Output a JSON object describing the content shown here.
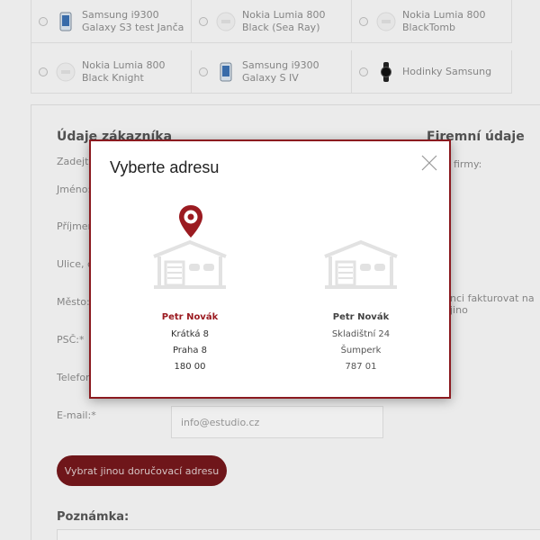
{
  "products": [
    {
      "name": "Samsung i9300 Galaxy S3 test Janča",
      "icon": "phone-icon"
    },
    {
      "name": "Nokia Lumia 800 Black (Sea Ray)",
      "icon": "phone-placeholder-icon"
    },
    {
      "name": "Nokia Lumia 800 BlackTomb",
      "icon": "phone-placeholder-icon"
    },
    {
      "name": "Nokia Lumia 800 Black Knight",
      "icon": "phone-placeholder-icon"
    },
    {
      "name": "Samsung i9300 Galaxy S IV",
      "icon": "phone-icon"
    },
    {
      "name": "Hodinky Samsung",
      "icon": "watch-icon"
    }
  ],
  "form": {
    "customer_heading": "Údaje zákazníka",
    "company_heading": "Firemní údaje",
    "intro_fragment": "Zadejte",
    "company_fragment": "firmy:",
    "invoice_fragment": "nci fakturovat na jino",
    "labels": {
      "first_name": "Jméno:",
      "last_name": "Příjmen",
      "street": "Ulice, č",
      "city": "Město:",
      "zip": "PSČ:*",
      "phone": "Telefon",
      "email": "E-mail:*"
    },
    "email_value": "info@estudio.cz",
    "alt_address_button": "Vybrat jinou doručovací adresu",
    "note_heading": "Poznámka:"
  },
  "modal": {
    "title": "Vyberte adresu",
    "accent_color": "#9b1b21",
    "addresses": [
      {
        "name": "Petr Novák",
        "street": "Krátká 8",
        "city": "Praha 8",
        "zip": "180 00",
        "selected": true
      },
      {
        "name": "Petr Novák",
        "street": "Skladištní 24",
        "city": "Šumperk",
        "zip": "787 01",
        "selected": false
      }
    ]
  }
}
